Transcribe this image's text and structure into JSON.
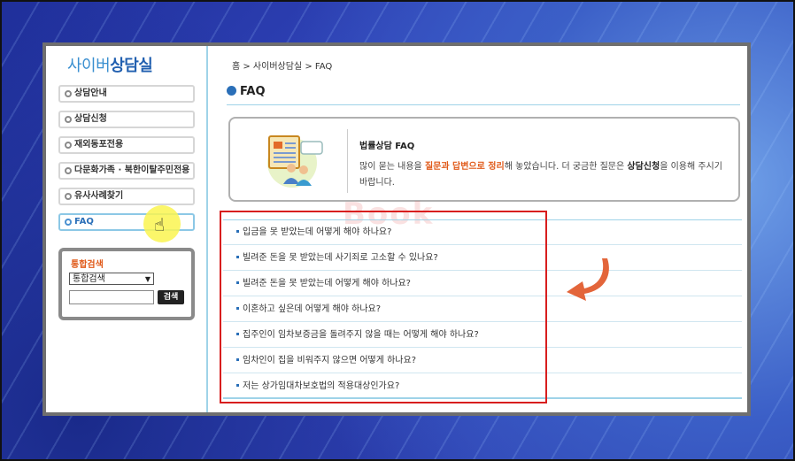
{
  "logo": {
    "part1": "사이버",
    "part2": "상담실"
  },
  "sidebar": {
    "items": [
      {
        "label": "상담안내"
      },
      {
        "label": "상담신청"
      },
      {
        "label": "재외동포전용"
      },
      {
        "label": "다문화가족 · 북한이탈주민전용"
      },
      {
        "label": "유사사례찾기"
      },
      {
        "label": "FAQ",
        "active": true
      }
    ]
  },
  "search": {
    "title": "통합검색",
    "select_value": "통합검색",
    "input_value": "",
    "button_label": "검색"
  },
  "breadcrumb": "홈 > 사이버상담실 > FAQ",
  "page_title": "FAQ",
  "intro": {
    "title": "법률상담 FAQ",
    "text_1": "많이 묻는 내용을 ",
    "highlight": "질문과 답변으로 정리",
    "text_2": "해 놓았습니다. 더 궁금한 질문은 ",
    "bold": "상담신청",
    "text_3": "을 이용해 주시기 바랍니다."
  },
  "watermark": "Book",
  "faq": [
    {
      "q": "입금을 못 받았는데 어떻게 해야 하나요?"
    },
    {
      "q": "빌려준 돈을 못 받았는데 사기죄로 고소할 수 있나요?"
    },
    {
      "q": "빌려준 돈을 못 받았는데 어떻게 해야 하나요?"
    },
    {
      "q": "이혼하고 싶은데 어떻게 해야 하나요?"
    },
    {
      "q": "집주인이 임차보증금을 돌려주지 않을 때는 어떻게 해야 하나요?"
    },
    {
      "q": "임차인이 집을 비워주지 않으면 어떻게 하나요?"
    },
    {
      "q": "저는 상가임대차보호법의 적용대상인가요?"
    }
  ],
  "colors": {
    "accent": "#2a6fb8",
    "highlight": "#e05a1a",
    "annotation": "#d81e1e"
  }
}
